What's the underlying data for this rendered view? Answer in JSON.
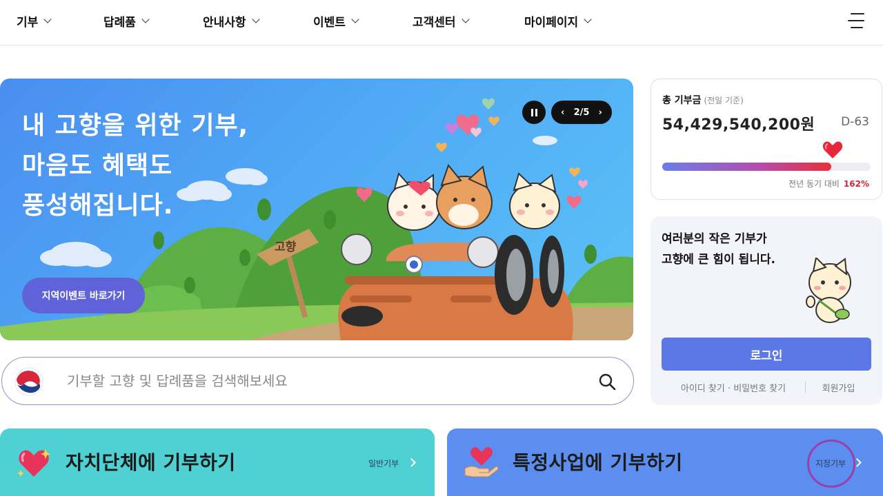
{
  "nav": {
    "items": [
      {
        "label": "기부"
      },
      {
        "label": "답례품"
      },
      {
        "label": "안내사항"
      },
      {
        "label": "이벤트"
      },
      {
        "label": "고객센터"
      },
      {
        "label": "마이페이지"
      }
    ],
    "menu_icon": "hamburger-menu-icon"
  },
  "hero": {
    "title": "내 고향을 위한 기부,\n마음도 혜택도\n풍성해집니다.",
    "button": "지역이벤트 바로가기",
    "sign_text": "고향",
    "pager": {
      "current": "2",
      "total": "/5"
    },
    "pause_icon": "pause-icon"
  },
  "search": {
    "placeholder": "기부할 고향 및 답례품을 검색해보세요",
    "value": ""
  },
  "stats": {
    "label": "총 기부금",
    "label_note": "(전일 기준)",
    "amount": "54,429,540,200원",
    "dday": "D-63",
    "progress_percent": 81,
    "compare_label": "전년 동기 대비",
    "compare_value": "162%"
  },
  "login": {
    "message": "여러분의 작은 기부가\n고향에 큰 힘이 됩니다.",
    "button": "로그인",
    "find_links": "아이디 찾기 · 비밀번호 찾기",
    "join": "회원가입"
  },
  "banners": {
    "left": {
      "title": "자치단체에 기부하기",
      "sub": "일반기부",
      "color": "#4fd0d2"
    },
    "right": {
      "title": "특정사업에 기부하기",
      "sub": "지정기부",
      "color": "#5c8ef0"
    }
  }
}
